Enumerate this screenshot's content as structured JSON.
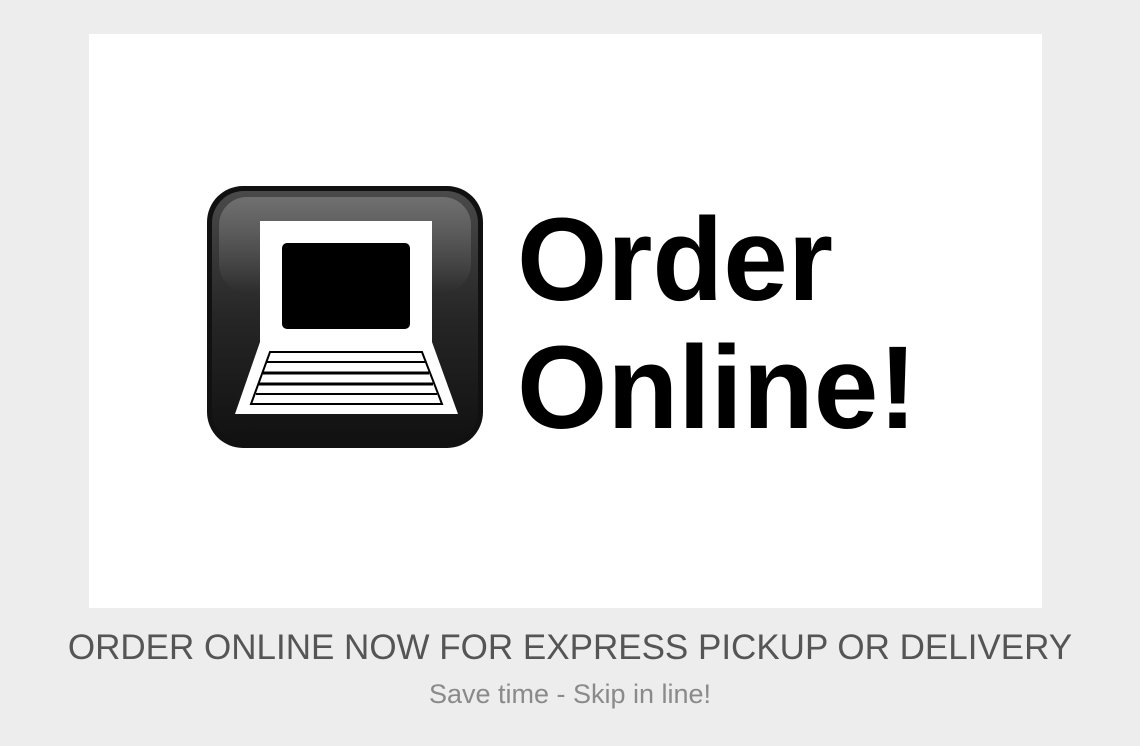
{
  "promo": {
    "image_text_line1": "Order",
    "image_text_line2": "Online!",
    "icon": "laptop-icon",
    "heading": "ORDER ONLINE NOW FOR EXPRESS PICKUP OR DELIVERY",
    "subheading": "Save time - Skip in line!"
  },
  "colors": {
    "page_background": "#ededed",
    "image_background": "#ffffff",
    "heading_text": "#555555",
    "subheading_text": "#8a8a8a",
    "logo_text": "#000000"
  }
}
